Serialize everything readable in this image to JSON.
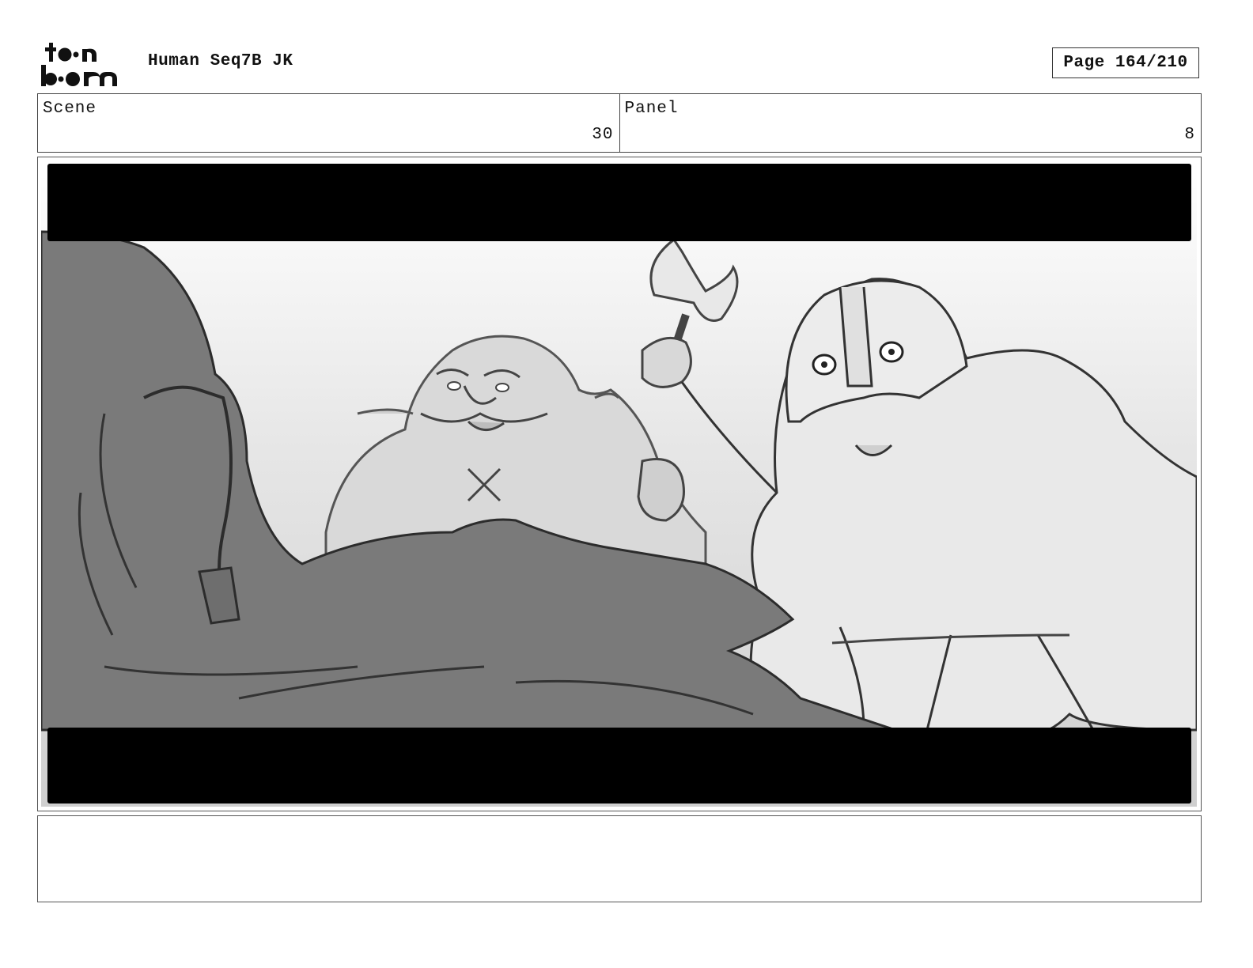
{
  "header": {
    "logo": {
      "line1": "toon",
      "line2": "boom",
      "icon": "toon-boom-logo"
    },
    "title": "Human Seq7B JK",
    "page_label": "Page 164/210"
  },
  "info": {
    "scene": {
      "label": "Scene",
      "value": "30"
    },
    "panel": {
      "label": "Panel",
      "value": "8"
    }
  },
  "panel_image": {
    "description_icon": "storyboard-sketch-two-dwarves-charging",
    "letterbox_color": "#000000"
  },
  "caption": {
    "text": ""
  }
}
